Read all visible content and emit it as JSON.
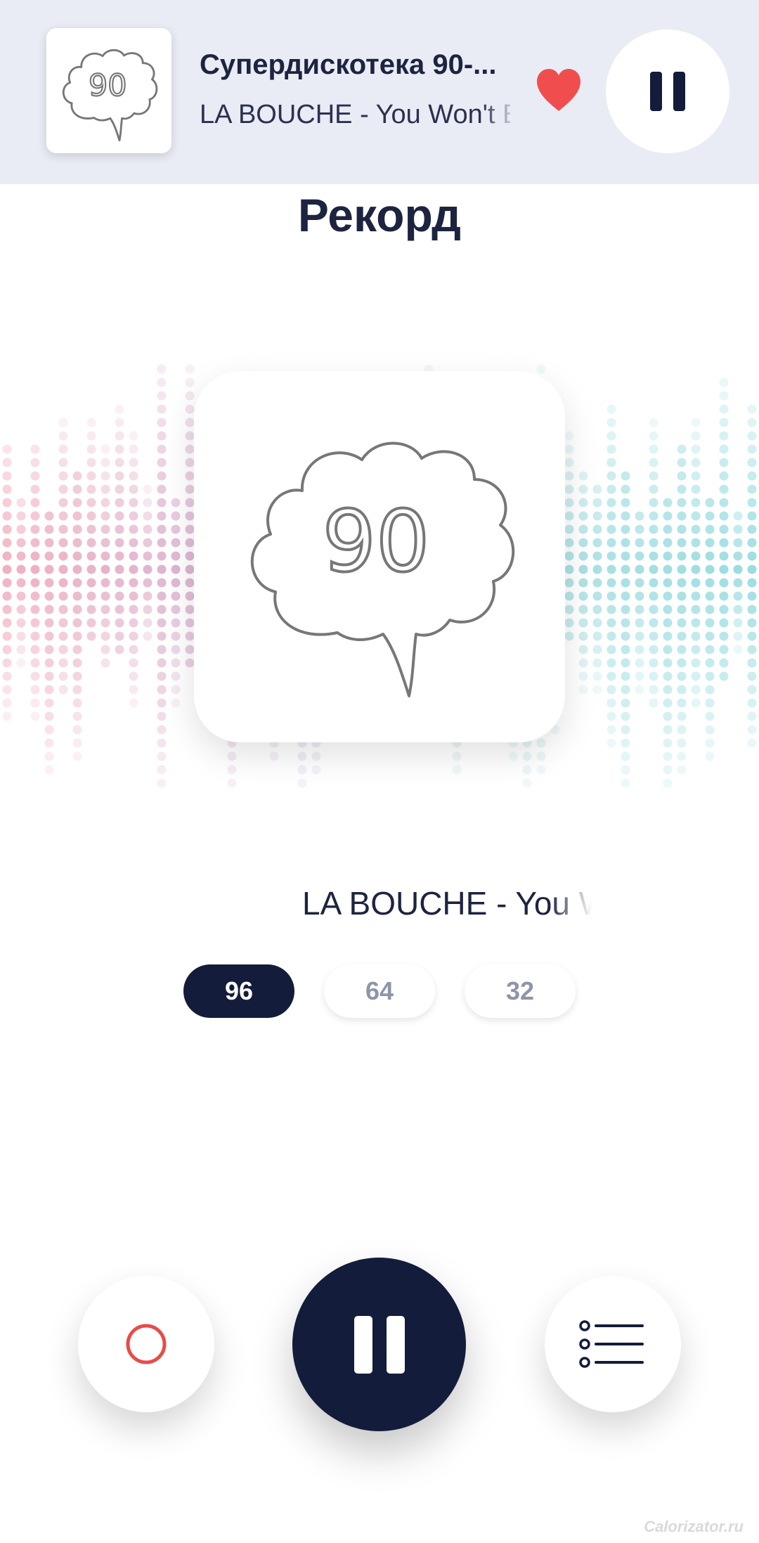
{
  "mini_player": {
    "station": "Супердискотека 90-...",
    "track": "LA BOUCHE - You Won't B",
    "artwork_label": "90",
    "favorite": true,
    "heart_color": "#f04e4e"
  },
  "station_title": "Рекорд",
  "artwork_label": "90",
  "now_playing": "LA BOUCHE - You Won't Be",
  "bitrates": [
    {
      "label": "96",
      "active": true
    },
    {
      "label": "64",
      "active": false
    },
    {
      "label": "32",
      "active": false
    }
  ],
  "controls": {
    "record_icon": "record-icon",
    "main_icon": "pause-icon",
    "playlist_icon": "playlist-icon"
  },
  "colors": {
    "dark": "#131c3a",
    "accent_red": "#e84b4b",
    "header_bg": "#eaecf5"
  },
  "watermark": "Calorizator.ru"
}
